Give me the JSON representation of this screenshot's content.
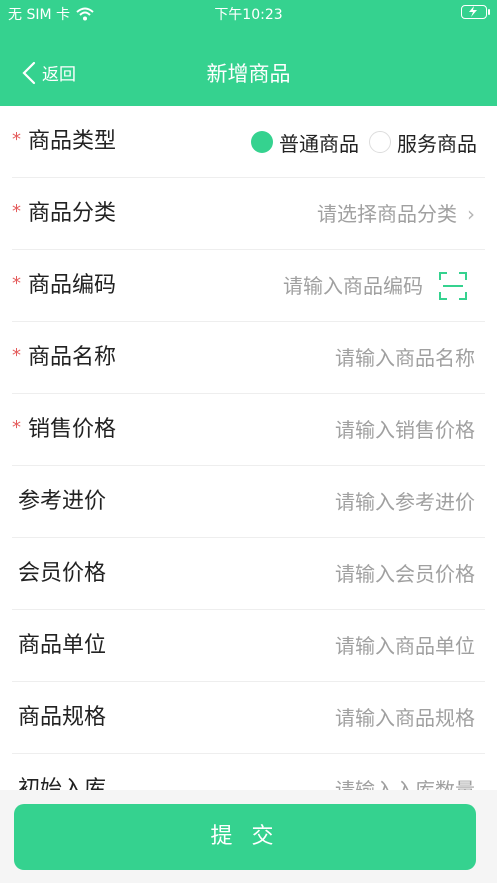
{
  "status_bar": {
    "carrier": "无 SIM 卡",
    "time": "下午10:23",
    "wifi_icon": "wifi-icon",
    "battery_icon": "battery-charging-icon"
  },
  "nav": {
    "back_label": "返回",
    "title": "新增商品"
  },
  "form": {
    "required_mark": "*",
    "type": {
      "label": "商品类型",
      "options": [
        {
          "label": "普通商品",
          "selected": true
        },
        {
          "label": "服务商品",
          "selected": false
        }
      ]
    },
    "category": {
      "label": "商品分类",
      "placeholder": "请选择商品分类",
      "chevron": "›"
    },
    "code": {
      "label": "商品编码",
      "placeholder": "请输入商品编码",
      "scan_icon": "scan-icon"
    },
    "name": {
      "label": "商品名称",
      "placeholder": "请输入商品名称"
    },
    "sale_price": {
      "label": "销售价格",
      "placeholder": "请输入销售价格"
    },
    "ref_price": {
      "label": "参考进价",
      "placeholder": "请输入参考进价"
    },
    "member_price": {
      "label": "会员价格",
      "placeholder": "请输入会员价格"
    },
    "unit": {
      "label": "商品单位",
      "placeholder": "请输入商品单位"
    },
    "spec": {
      "label": "商品规格",
      "placeholder": "请输入商品规格"
    },
    "initial_stock": {
      "label": "初始入库",
      "placeholder": "请输入入库数量"
    }
  },
  "submit_label": "提 交",
  "colors": {
    "accent": "#35d28f",
    "required": "#e45b5b",
    "placeholder": "#a0a0a0"
  }
}
